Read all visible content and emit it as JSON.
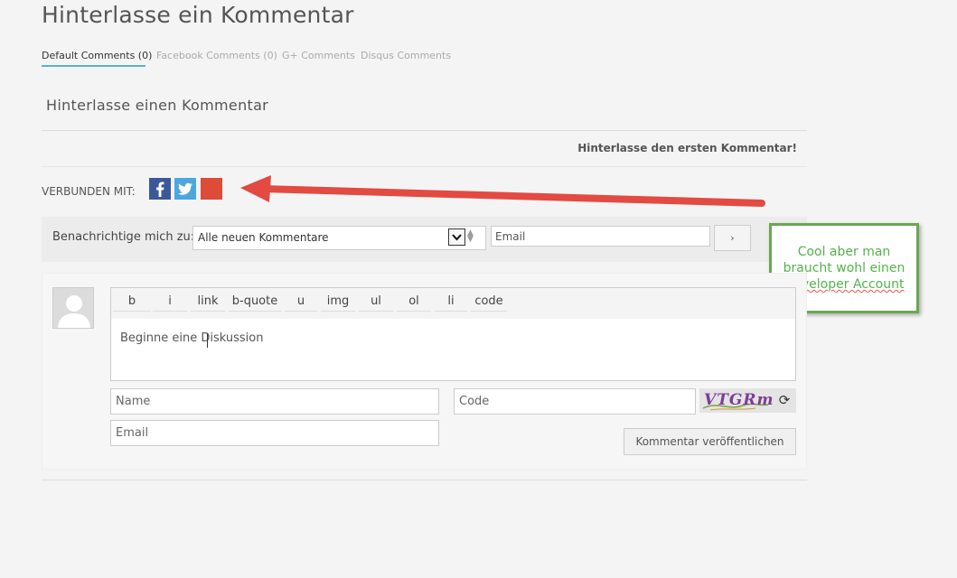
{
  "page": {
    "title": "Hinterlasse ein Kommentar"
  },
  "tabs": [
    {
      "label": "Default Comments (0)"
    },
    {
      "label": "Facebook Comments (0)"
    },
    {
      "label": "G+ Comments"
    },
    {
      "label": "Disqus Comments"
    }
  ],
  "section": {
    "title": "Hinterlasse einen Kommentar",
    "first_comment": "Hinterlasse den ersten Kommentar!"
  },
  "connect": {
    "label": "VERBUNDEN MIT:",
    "icons": [
      "facebook-icon",
      "twitter-icon",
      "google-plus-icon"
    ],
    "colors": {
      "facebook": "#3b5998",
      "twitter": "#4da7de",
      "google": "#dd4b39"
    }
  },
  "subscribe": {
    "label": "Benachrichtige mich zu:",
    "select_value": "Alle neuen Kommentare",
    "email_value": "Email",
    "go_label": "›"
  },
  "note": {
    "line1": "Cool aber man",
    "line2": "braucht wohl einen",
    "line3": "Developer Account"
  },
  "editor": {
    "tools": [
      "b",
      "i",
      "link",
      "b-quote",
      "u",
      "img",
      "ul",
      "ol",
      "li",
      "code"
    ],
    "text": "Beginne eine Diskussion"
  },
  "form": {
    "name_placeholder": "Name",
    "code_placeholder": "Code",
    "email_placeholder": "Email",
    "captcha": "VTGRm",
    "refresh_icon": "refresh-icon",
    "submit_label": "Kommentar veröffentlichen"
  },
  "annotation": {
    "arrow_color": "#e24a42",
    "note_border": "#6aa84f",
    "note_text_color": "#55b14d"
  }
}
